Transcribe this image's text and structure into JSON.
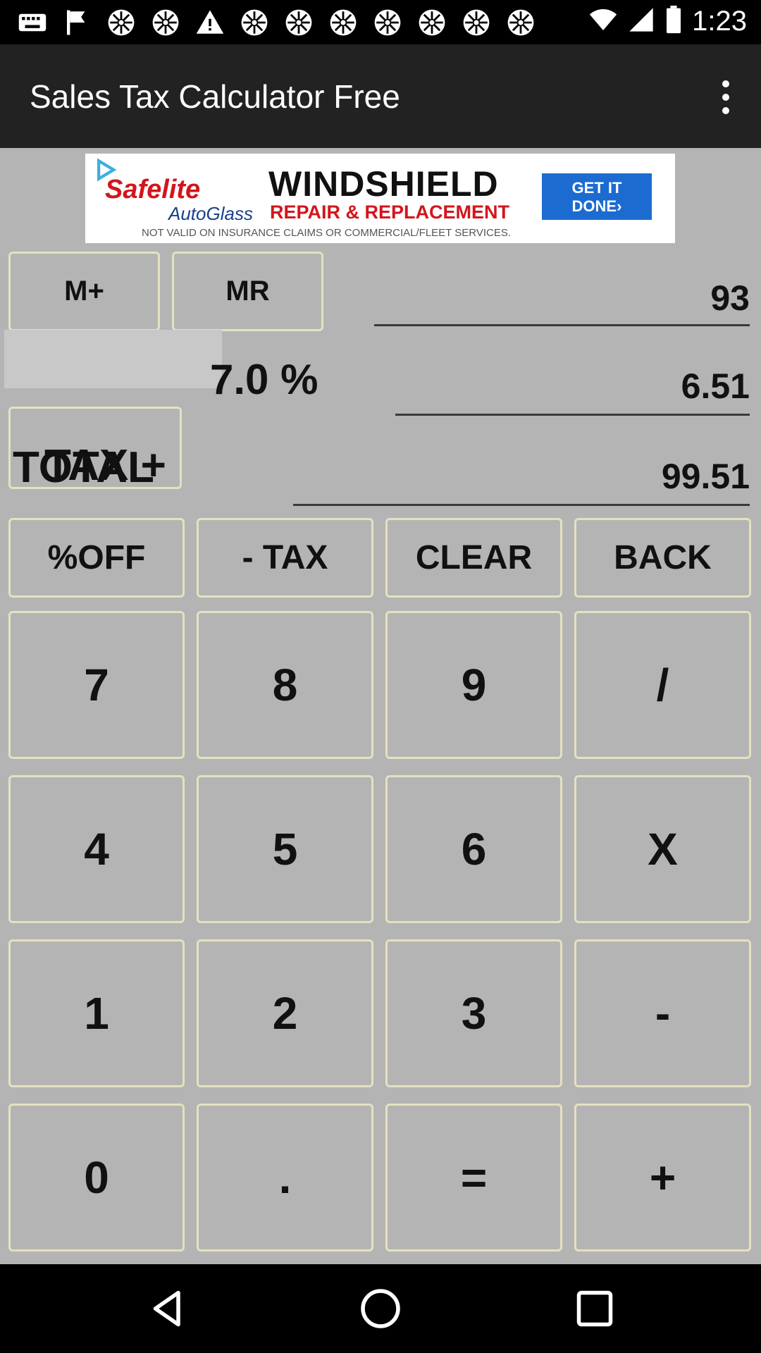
{
  "status_bar": {
    "time": "1:23",
    "notification_icons": [
      "keyboard-icon",
      "flag-icon",
      "settings-wheel-icon",
      "settings-wheel-icon",
      "warning-icon",
      "settings-wheel-icon",
      "settings-wheel-icon",
      "settings-wheel-icon",
      "settings-wheel-icon",
      "settings-wheel-icon",
      "settings-wheel-icon"
    ]
  },
  "app_bar": {
    "title": "Sales Tax Calculator Free"
  },
  "ad": {
    "brand": "Safelite",
    "brand_sub": "AutoGlass",
    "headline": "WINDSHIELD",
    "subhead": "REPAIR & REPLACEMENT",
    "cta_line1": "GET IT",
    "cta_line2": "DONE›",
    "disclaimer": "NOT VALID ON INSURANCE CLAIMS OR COMMERCIAL/FLEET SERVICES."
  },
  "memory": {
    "m_plus": "M+",
    "mr": "MR"
  },
  "display": {
    "amount": "93",
    "tax_label": "TAX +",
    "tax_rate": "7.0 %",
    "tax_amount": "6.51",
    "total_label": "TOTAL",
    "total": "99.51"
  },
  "functions": {
    "off": "%OFF",
    "minus_tax": "- TAX",
    "clear": "CLEAR",
    "back": "BACK"
  },
  "keys": {
    "k7": "7",
    "k8": "8",
    "k9": "9",
    "div": "/",
    "k4": "4",
    "k5": "5",
    "k6": "6",
    "mul": "X",
    "k1": "1",
    "k2": "2",
    "k3": "3",
    "sub": "-",
    "k0": "0",
    "dot": ".",
    "eq": "=",
    "add": "+"
  },
  "colors": {
    "background": "#b4b4b4",
    "button_border": "#e4e1c0",
    "app_bar": "#222222"
  }
}
